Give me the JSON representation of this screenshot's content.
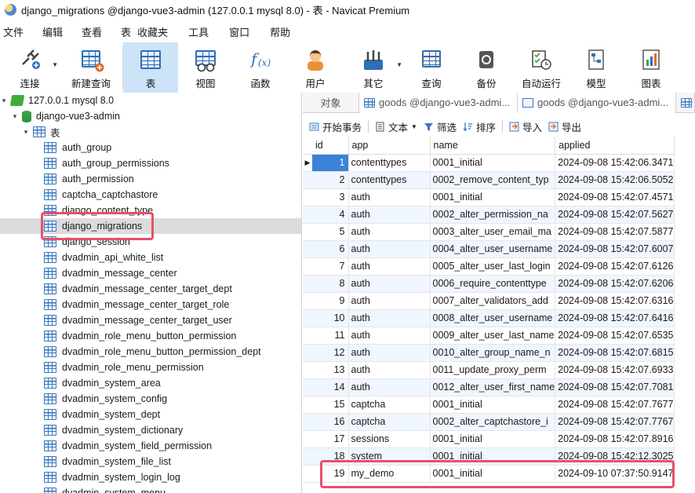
{
  "window": {
    "title": "django_migrations @django-vue3-admin (127.0.0.1 mysql 8.0) - 表 - Navicat Premium"
  },
  "menu": [
    "文件",
    "编辑",
    "查看",
    "表",
    "收藏夹",
    "工具",
    "窗口",
    "帮助"
  ],
  "toolbar": [
    {
      "label": "连接",
      "icon": "plug-icon",
      "dropdown": true
    },
    {
      "label": "新建查询",
      "icon": "new-query-icon"
    },
    {
      "label": "表",
      "icon": "table-icon",
      "active": true
    },
    {
      "label": "视图",
      "icon": "view-icon"
    },
    {
      "label": "函数",
      "icon": "function-icon"
    },
    {
      "label": "用户",
      "icon": "user-icon"
    },
    {
      "label": "其它",
      "icon": "tools-icon",
      "dropdown": true
    },
    {
      "label": "查询",
      "icon": "query-icon"
    },
    {
      "label": "备份",
      "icon": "backup-icon"
    },
    {
      "label": "自动运行",
      "icon": "schedule-icon"
    },
    {
      "label": "模型",
      "icon": "model-icon"
    },
    {
      "label": "图表",
      "icon": "chart-icon"
    }
  ],
  "tree": {
    "connection": "127.0.0.1 mysql 8.0",
    "database": "django-vue3-admin",
    "folder": "表",
    "tables": [
      "auth_group",
      "auth_group_permissions",
      "auth_permission",
      "captcha_captchastore",
      "django_content_type",
      "django_migrations",
      "django_session",
      "dvadmin_api_white_list",
      "dvadmin_message_center",
      "dvadmin_message_center_target_dept",
      "dvadmin_message_center_target_role",
      "dvadmin_message_center_target_user",
      "dvadmin_role_menu_button_permission",
      "dvadmin_role_menu_button_permission_dept",
      "dvadmin_role_menu_permission",
      "dvadmin_system_area",
      "dvadmin_system_config",
      "dvadmin_system_dept",
      "dvadmin_system_dictionary",
      "dvadmin_system_field_permission",
      "dvadmin_system_file_list",
      "dvadmin_system_login_log",
      "dvadmin_system_menu"
    ],
    "selected": "django_migrations"
  },
  "tabs": {
    "objects": "对象",
    "tab1": "goods @django-vue3-admi...",
    "tab2": "goods @django-vue3-admi..."
  },
  "subtoolbar": {
    "begin_txn": "开始事务",
    "text": "文本",
    "filter": "筛选",
    "sort": "排序",
    "import": "导入",
    "export": "导出"
  },
  "grid": {
    "columns": [
      "id",
      "app",
      "name",
      "applied"
    ],
    "rows": [
      [
        "1",
        "contenttypes",
        "0001_initial",
        "2024-09-08 15:42:06.3471"
      ],
      [
        "2",
        "contenttypes",
        "0002_remove_content_typ",
        "2024-09-08 15:42:06.5052"
      ],
      [
        "3",
        "auth",
        "0001_initial",
        "2024-09-08 15:42:07.4571"
      ],
      [
        "4",
        "auth",
        "0002_alter_permission_na",
        "2024-09-08 15:42:07.5627"
      ],
      [
        "5",
        "auth",
        "0003_alter_user_email_ma",
        "2024-09-08 15:42:07.5877"
      ],
      [
        "6",
        "auth",
        "0004_alter_user_username",
        "2024-09-08 15:42:07.6007"
      ],
      [
        "7",
        "auth",
        "0005_alter_user_last_login",
        "2024-09-08 15:42:07.6126"
      ],
      [
        "8",
        "auth",
        "0006_require_contenttype",
        "2024-09-08 15:42:07.6206"
      ],
      [
        "9",
        "auth",
        "0007_alter_validators_add",
        "2024-09-08 15:42:07.6316"
      ],
      [
        "10",
        "auth",
        "0008_alter_user_username",
        "2024-09-08 15:42:07.6416"
      ],
      [
        "11",
        "auth",
        "0009_alter_user_last_name",
        "2024-09-08 15:42:07.6535"
      ],
      [
        "12",
        "auth",
        "0010_alter_group_name_n",
        "2024-09-08 15:42:07.6815"
      ],
      [
        "13",
        "auth",
        "0011_update_proxy_perm",
        "2024-09-08 15:42:07.6933"
      ],
      [
        "14",
        "auth",
        "0012_alter_user_first_name",
        "2024-09-08 15:42:07.7081"
      ],
      [
        "15",
        "captcha",
        "0001_initial",
        "2024-09-08 15:42:07.7677"
      ],
      [
        "16",
        "captcha",
        "0002_alter_captchastore_i",
        "2024-09-08 15:42:07.7767"
      ],
      [
        "17",
        "sessions",
        "0001_initial",
        "2024-09-08 15:42:07.8916"
      ],
      [
        "18",
        "system",
        "0001_initial",
        "2024-09-08 15:42:12.3025"
      ],
      [
        "19",
        "my_demo",
        "0001_initial",
        "2024-09-10 07:37:50.9147"
      ]
    ]
  },
  "colors": {
    "accent": "#3b82d8",
    "highlight": "#e8506a",
    "active_tool": "#cde3f7"
  }
}
